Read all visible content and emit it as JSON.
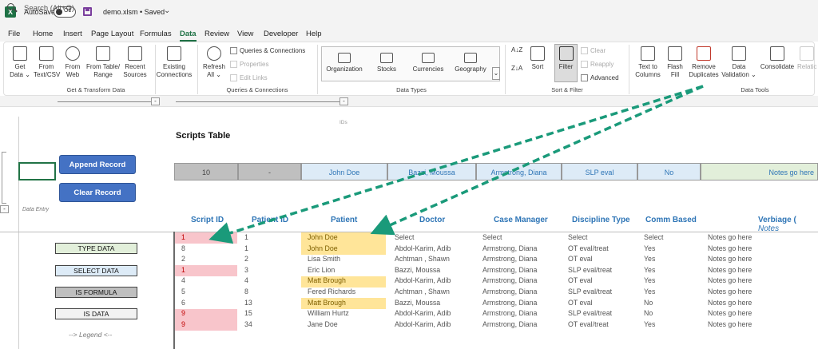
{
  "titlebar": {
    "logo": "X",
    "autosave_label": "AutoSave",
    "autosave_state": "Off",
    "filename": "demo.xlsm • Saved",
    "chevron": "⌄",
    "search_placeholder": "Search (Alt+Q)"
  },
  "menu": [
    "File",
    "Home",
    "Insert",
    "Page Layout",
    "Formulas",
    "Data",
    "Review",
    "View",
    "Developer",
    "Help"
  ],
  "menu_active": "Data",
  "ribbon": {
    "get_data": [
      "Get",
      "Data ⌄"
    ],
    "from_text": [
      "From",
      "Text/CSV"
    ],
    "from_web": [
      "From",
      "Web"
    ],
    "from_table": [
      "From Table/",
      "Range"
    ],
    "recent_sources": [
      "Recent",
      "Sources"
    ],
    "existing_connections": [
      "Existing",
      "Connections"
    ],
    "refresh_all": [
      "Refresh",
      "All ⌄"
    ],
    "queries_connections": "Queries & Connections",
    "properties": "Properties",
    "edit_links": "Edit Links",
    "data_types": [
      "Organization",
      "Stocks",
      "Currencies",
      "Geography"
    ],
    "sort_az": "A↓Z",
    "sort_za": "Z↓A",
    "sort": "Sort",
    "filter": "Filter",
    "clear": "Clear",
    "reapply": "Reapply",
    "advanced": "Advanced",
    "text_to_columns": [
      "Text to",
      "Columns"
    ],
    "flash_fill": [
      "Flash",
      "Fill"
    ],
    "remove_duplicates": [
      "Remove",
      "Duplicates"
    ],
    "data_validation": [
      "Data",
      "Validation ⌄"
    ],
    "consolidate": "Consolidate",
    "relationships": "Relatio",
    "groups": {
      "get_transform": "Get & Transform Data",
      "queries": "Queries & Connections",
      "data_types": "Data Types",
      "sort_filter": "Sort & Filter",
      "data_tools": "Data Tools"
    }
  },
  "sheet": {
    "ids_label": "IDs",
    "title": "Scripts Table",
    "append_button": "Append Record",
    "clear_button": "Clear Record",
    "data_entry_label": "Data Entry",
    "collapse_glyph": "-",
    "input_row": [
      "10",
      "-",
      "John Doe",
      "Bazzi, Moussa",
      "Armstrong, Diana",
      "SLP eval",
      "No",
      "Notes go here"
    ],
    "headers": [
      "Script ID",
      "Patient ID",
      "Patient",
      "Doctor",
      "Case Manager",
      "Discipline Type",
      "Comm Based",
      "Verbiage ("
    ],
    "headers_extra": "Notes",
    "rows": [
      [
        "1",
        "1",
        "John Doe",
        "Select",
        "Select",
        "Select",
        "Select",
        "Notes go here"
      ],
      [
        "8",
        "1",
        "John Doe",
        "Abdol-Karim, Adib",
        "Armstrong, Diana",
        "OT eval/treat",
        "Yes",
        "Notes go here"
      ],
      [
        "2",
        "2",
        "Lisa Smith",
        "Achtman , Shawn",
        "Armstrong, Diana",
        "OT eval",
        "Yes",
        "Notes go here"
      ],
      [
        "1",
        "3",
        "Eric Lion",
        "Bazzi, Moussa",
        "Armstrong, Diana",
        "SLP eval/treat",
        "Yes",
        "Notes go here"
      ],
      [
        "4",
        "4",
        "Matt Brough",
        "Abdol-Karim, Adib",
        "Armstrong, Diana",
        "OT eval",
        "Yes",
        "Notes go here"
      ],
      [
        "5",
        "8",
        "Fered Richards",
        "Achtman , Shawn",
        "Armstrong, Diana",
        "SLP eval/treat",
        "Yes",
        "Notes go here"
      ],
      [
        "6",
        "13",
        "Matt Brough",
        "Bazzi, Moussa",
        "Armstrong, Diana",
        "OT eval",
        "No",
        "Notes go here"
      ],
      [
        "9",
        "15",
        "William Hurtz",
        "Abdol-Karim, Adib",
        "Armstrong, Diana",
        "SLP eval/treat",
        "No",
        "Notes go here"
      ],
      [
        "9",
        "34",
        "Jane Doe",
        "Abdol-Karim, Adib",
        "Armstrong, Diana",
        "OT eval/treat",
        "Yes",
        "Notes go here"
      ]
    ],
    "legend": {
      "type_data": "TYPE DATA",
      "select_data": "SELECT DATA",
      "is_formula": "IS FORMULA",
      "is_data": "IS DATA",
      "caption": "-->  Legend  <--"
    }
  },
  "colors": {
    "excel_green": "#1e7145",
    "button_blue": "#4472c4",
    "header_blue": "#2e75b6",
    "dup_pink": "#f8c5cb",
    "dup_yellow": "#ffe599",
    "arrow_teal": "#1a9a7a"
  }
}
